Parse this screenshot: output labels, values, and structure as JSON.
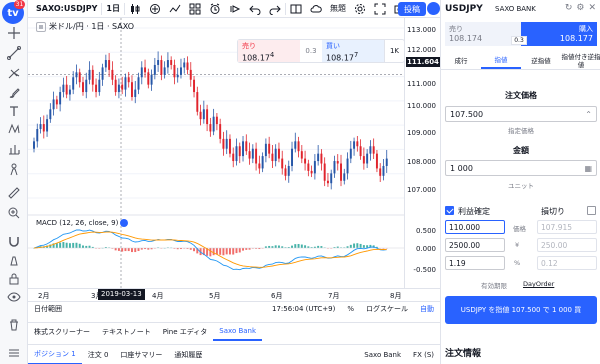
{
  "toolbar": {
    "badge": "tv",
    "notifications": "31",
    "symbol": "SAXO:USDJPY",
    "interval": "1日",
    "undo_icon": "undo-icon",
    "autosave": "無題",
    "publish": "投稿"
  },
  "legend": {
    "name": "米ドル/円 · 1日 · SAXO"
  },
  "quote": {
    "sell_label": "売り",
    "sell_value": "108.17",
    "sell_sup": "4",
    "spread": "0.3",
    "buy_label": "買い",
    "buy_value": "108.17",
    "buy_sup": "7",
    "lot": "1K"
  },
  "price_scale": {
    "ticks": [
      "113.000",
      "112.000",
      "111.000",
      "110.000",
      "109.000",
      "108.000",
      "107.000",
      "0.500",
      "0.000",
      "-0.500"
    ],
    "current": "111.604"
  },
  "macd": {
    "label": "MACD (12, 26, close, 9)"
  },
  "time_axis": {
    "labels": [
      "2月",
      "3月",
      "4月",
      "5月",
      "6月",
      "7月",
      "8月"
    ],
    "cursor": "2019-03-13"
  },
  "range_bar": {
    "range": "日付範囲",
    "time": "17:56:04 (UTC+9)",
    "percent": "%",
    "log": "ログスケール",
    "auto": "自動"
  },
  "bottom_tabs": [
    "株式スクリーナー",
    "テキストノート",
    "Pine エディタ",
    "Saxo Bank"
  ],
  "positions_bar": {
    "positions": "ポジション",
    "positions_count": "1",
    "orders": "注文",
    "orders_count": "0",
    "account": "口座サマリー",
    "notifications": "通知履歴",
    "broker": "Saxo Bank",
    "fx": "FX (S)"
  },
  "panel": {
    "title": "USDJPY",
    "broker": "SAXO BANK",
    "sell_label": "売り",
    "sell_value": "108.174",
    "buy_label": "購入",
    "buy_value": "108.177",
    "spread": "0.3",
    "order_types": [
      "成行",
      "指値",
      "逆指値",
      "指値付き逆指値"
    ],
    "price_title": "注文価格",
    "price_value": "107.500",
    "price_sub": "指定価格",
    "amount_title": "金額",
    "amount_value": "1 000",
    "amount_sub": "ユニット",
    "tp_label": "利益確定",
    "sl_label": "損切り",
    "tp_price": "110.000",
    "tp_price_lbl": "価格",
    "sl_price": "107.915",
    "tp_amount": "2500.00",
    "tp_amount_lbl": "¥",
    "sl_amount": "250.00",
    "tp_pct": "1.19",
    "tp_pct_lbl": "%",
    "sl_pct": "0.12",
    "expiry_label": "有効期限",
    "expiry_value": "DayOrder",
    "submit": "USDJPY を指値 107.500 で 1 000 買",
    "order_info": "注文情報"
  },
  "chart_data": {
    "type": "candlestick",
    "y_range": [
      106.6,
      113.5
    ],
    "closes": [
      108.9,
      109.4,
      109.6,
      109.3,
      109.8,
      110.2,
      110.6,
      110.4,
      110.9,
      111.2,
      110.8,
      111.0,
      111.5,
      111.7,
      111.3,
      110.9,
      111.4,
      111.8,
      111.2,
      110.9,
      111.4,
      111.9,
      112.2,
      111.8,
      111.4,
      110.9,
      111.2,
      111.0,
      111.5,
      111.3,
      110.7,
      111.0,
      111.5,
      111.9,
      111.7,
      111.2,
      111.6,
      112.0,
      112.2,
      111.6,
      111.9,
      112.2,
      112.0,
      111.5,
      111.6,
      111.9,
      112.1,
      111.8,
      111.4,
      110.9,
      110.1,
      109.8,
      110.2,
      109.6,
      109.3,
      109.9,
      109.6,
      109.0,
      108.6,
      109.0,
      108.4,
      108.1,
      108.7,
      108.3,
      108.9,
      108.5,
      108.2,
      108.6,
      108.0,
      107.8,
      108.3,
      108.8,
      108.4,
      108.1,
      108.6,
      108.2,
      107.8,
      107.5,
      107.9,
      108.6,
      108.9,
      108.5,
      108.2,
      108.0,
      107.7,
      107.6,
      108.1,
      108.4,
      108.0,
      107.3,
      107.2,
      107.6,
      108.1,
      108.0,
      107.3,
      107.6,
      108.2,
      108.6,
      108.9,
      108.7,
      108.3,
      108.0,
      108.4,
      108.7,
      108.4,
      107.8,
      107.5,
      107.9,
      108.2
    ]
  }
}
